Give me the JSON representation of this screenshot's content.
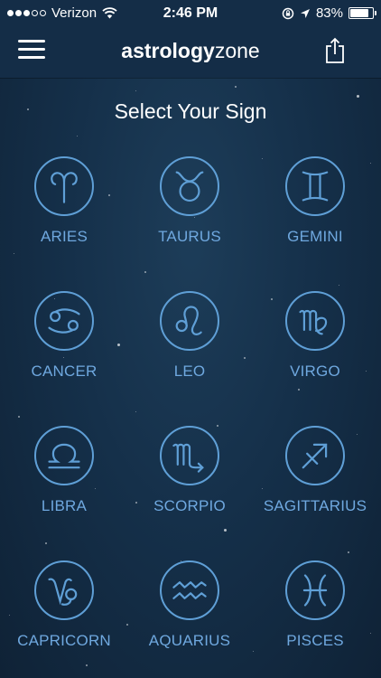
{
  "status_bar": {
    "carrier": "Verizon",
    "time": "2:46 PM",
    "battery_percent_label": "83%",
    "battery_level": 0.83,
    "signal_bars_filled": 3,
    "signal_bars_total": 5
  },
  "nav": {
    "brand_bold": "astrology",
    "brand_light": "zone",
    "menu_icon": "hamburger-menu-icon",
    "share_icon": "share-icon"
  },
  "title": "Select Your Sign",
  "accent_color": "#5f9fd6",
  "signs": [
    {
      "label": "ARIES",
      "icon": "aries-icon"
    },
    {
      "label": "TAURUS",
      "icon": "taurus-icon"
    },
    {
      "label": "GEMINI",
      "icon": "gemini-icon"
    },
    {
      "label": "CANCER",
      "icon": "cancer-icon"
    },
    {
      "label": "LEO",
      "icon": "leo-icon"
    },
    {
      "label": "VIRGO",
      "icon": "virgo-icon"
    },
    {
      "label": "LIBRA",
      "icon": "libra-icon"
    },
    {
      "label": "SCORPIO",
      "icon": "scorpio-icon"
    },
    {
      "label": "SAGITTARIUS",
      "icon": "sagittarius-icon"
    },
    {
      "label": "CAPRICORN",
      "icon": "capricorn-icon"
    },
    {
      "label": "AQUARIUS",
      "icon": "aquarius-icon"
    },
    {
      "label": "PISCES",
      "icon": "pisces-icon"
    }
  ]
}
